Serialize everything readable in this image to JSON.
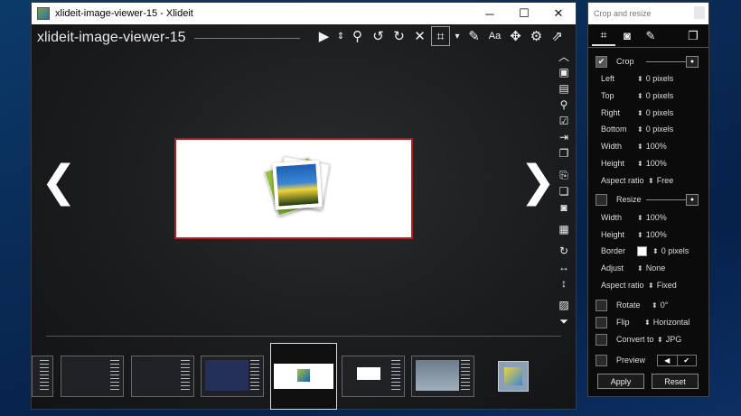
{
  "window": {
    "title": "xlideit-image-viewer-15 - Xlideit",
    "min": "─",
    "max": "☐",
    "close": "✕"
  },
  "viewer": {
    "title": "xlideit-image-viewer-15"
  },
  "toolbar": [
    {
      "name": "play-icon",
      "glyph": "▶"
    },
    {
      "name": "sort-icon",
      "glyph": "⇕"
    },
    {
      "name": "zoom-icon",
      "glyph": "⚲"
    },
    {
      "name": "rotate-left-icon",
      "glyph": "↺"
    },
    {
      "name": "rotate-right-icon",
      "glyph": "↻"
    },
    {
      "name": "close-icon",
      "glyph": "✕"
    },
    {
      "name": "crop-icon",
      "glyph": "⌗"
    },
    {
      "name": "dropdown-icon",
      "glyph": "▾"
    },
    {
      "name": "edit-icon",
      "glyph": "✎"
    },
    {
      "name": "text-icon",
      "glyph": "Aa"
    },
    {
      "name": "move-icon",
      "glyph": "✥"
    },
    {
      "name": "settings-icon",
      "glyph": "⚙"
    },
    {
      "name": "external-icon",
      "glyph": "⇗"
    }
  ],
  "sidebar": [
    {
      "name": "collapse-up-icon",
      "glyph": "︿"
    },
    {
      "name": "camera-icon",
      "glyph": "▣"
    },
    {
      "name": "clipboard-icon",
      "glyph": "▤"
    },
    {
      "name": "find-icon",
      "glyph": "⚲"
    },
    {
      "name": "check-icon",
      "glyph": "☑"
    },
    {
      "name": "export-icon",
      "glyph": "⇥"
    },
    {
      "name": "copy-icon",
      "glyph": "❐"
    },
    {
      "name": "paste-icon",
      "glyph": "⎘"
    },
    {
      "name": "duplicate-icon",
      "glyph": "❏"
    },
    {
      "name": "snapshot-icon",
      "glyph": "◙"
    },
    {
      "name": "calendar-icon",
      "glyph": "▦"
    },
    {
      "name": "refresh-icon",
      "glyph": "↻"
    },
    {
      "name": "fit-width-icon",
      "glyph": "↔"
    },
    {
      "name": "fit-height-icon",
      "glyph": "↕"
    },
    {
      "name": "image-icon",
      "glyph": "▨"
    },
    {
      "name": "expand-down-icon",
      "glyph": "⏷"
    }
  ],
  "nav": {
    "prev": "❮",
    "next": "❯"
  },
  "panel": {
    "title": "Crop and resize",
    "tabs": [
      {
        "name": "crop-tab-icon",
        "glyph": "⌗"
      },
      {
        "name": "camera-tab-icon",
        "glyph": "◙"
      },
      {
        "name": "edit-tab-icon",
        "glyph": "✎"
      },
      {
        "name": "window-tab-icon",
        "glyph": "❐"
      }
    ],
    "crop": {
      "label": "Crop",
      "checked": "✔"
    },
    "left": {
      "label": "Left",
      "value": "0 pixels"
    },
    "top": {
      "label": "Top",
      "value": "0 pixels"
    },
    "right": {
      "label": "Right",
      "value": "0 pixels"
    },
    "bottom": {
      "label": "Bottom",
      "value": "0 pixels"
    },
    "width1": {
      "label": "Width",
      "value": "100%"
    },
    "height1": {
      "label": "Height",
      "value": "100%"
    },
    "aspect1": {
      "label": "Aspect ratio",
      "value": "Free"
    },
    "resize": {
      "label": "Resize"
    },
    "width2": {
      "label": "Width",
      "value": "100%"
    },
    "height2": {
      "label": "Height",
      "value": "100%"
    },
    "border": {
      "label": "Border",
      "value": "0 pixels"
    },
    "adjust": {
      "label": "Adjust",
      "value": "None"
    },
    "aspect2": {
      "label": "Aspect ratio",
      "value": "Fixed"
    },
    "rotate": {
      "label": "Rotate",
      "value": "0°"
    },
    "flip": {
      "label": "Flip",
      "value": "Horizontal"
    },
    "convert": {
      "label": "Convert to",
      "value": "JPG"
    },
    "preview": {
      "label": "Preview",
      "back": "◀",
      "ok": "✔"
    },
    "apply": "Apply",
    "reset": "Reset",
    "spin": "⬍"
  }
}
